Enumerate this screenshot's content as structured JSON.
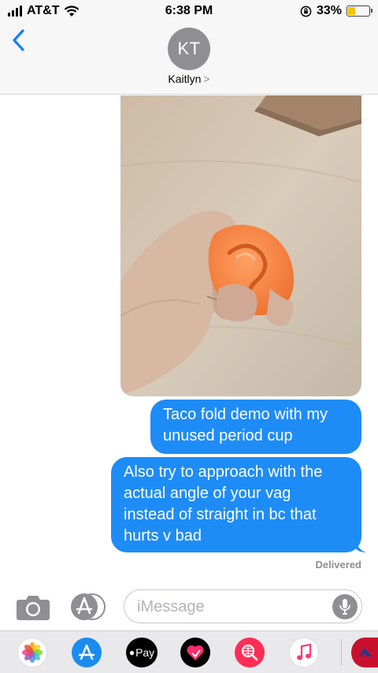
{
  "status_bar": {
    "carrier": "AT&T",
    "time": "6:38 PM",
    "battery_percent": "33%",
    "battery_level": 0.33,
    "battery_color": "#f4c400"
  },
  "header": {
    "back_icon": "chevron-left-icon",
    "avatar_initials": "KT",
    "contact_name": "Kaitlyn",
    "contact_chevron": ">"
  },
  "messages": [
    {
      "type": "photo",
      "description_icon": "image",
      "sender": "me"
    },
    {
      "type": "text",
      "sender": "me",
      "lines": [
        "Taco fold demo with my",
        "unused period cup"
      ]
    },
    {
      "type": "text",
      "sender": "me",
      "lines": [
        "Also try to approach with the",
        "actual angle of your vag",
        "instead of straight in bc that",
        "hurts v bad"
      ]
    }
  ],
  "delivery_status": "Delivered",
  "input_bar": {
    "placeholder": "iMessage",
    "value": ""
  },
  "app_drawer": {
    "apple_pay_label": "Pay",
    "apps": [
      "photos-icon",
      "app-store-icon",
      "apple-pay-icon",
      "heart-sticker-icon",
      "web-search-icon",
      "music-icon"
    ]
  },
  "colors": {
    "bubble_blue": "#1e8cf7",
    "ios_blue": "#147efb",
    "gray": "#8e8e93"
  }
}
